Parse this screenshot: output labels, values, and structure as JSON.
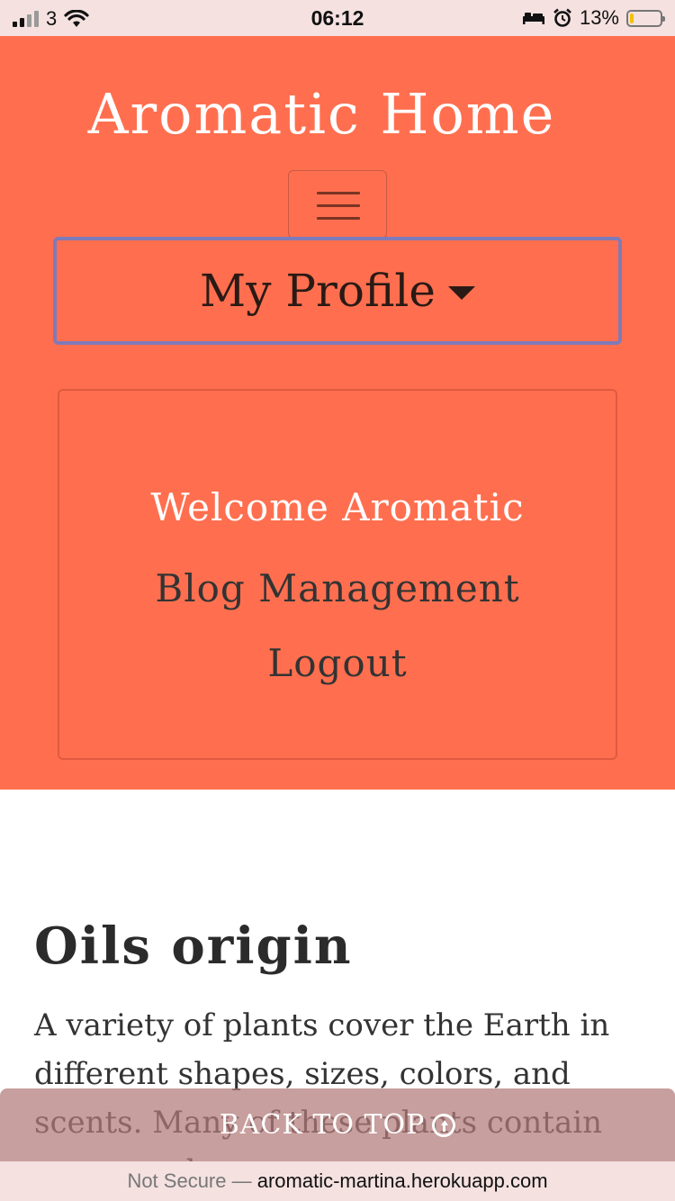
{
  "status_bar": {
    "carrier": "3",
    "time": "06:12",
    "battery_percent": "13%",
    "battery_level": 0.13,
    "icons": [
      "signal-icon",
      "wifi-icon",
      "bed-icon",
      "alarm-icon",
      "battery-icon"
    ]
  },
  "header": {
    "brand": "Aromatic Home",
    "menu_toggle_icon": "hamburger-icon",
    "profile_label": "My Profile",
    "dropdown": {
      "welcome": "Welcome Aromatic",
      "blog_management": "Blog Management",
      "logout": "Logout"
    }
  },
  "main": {
    "title": "Oils origin",
    "paragraph": "A variety of plants cover the Earth in different shapes, sizes, colors, and scents. Many of these plants contain compounds"
  },
  "back_to_top": {
    "label": "BACK TO TOP",
    "icon": "arrow-up-circle-icon"
  },
  "url_bar": {
    "security": "Not Secure —",
    "domain": "aromatic-martina.herokuapp.com"
  },
  "colors": {
    "header_bg": "#ff6f4f",
    "profile_border": "#7f7ab8",
    "status_bg": "#f4e1e0",
    "battery_fill": "#f2c200"
  }
}
